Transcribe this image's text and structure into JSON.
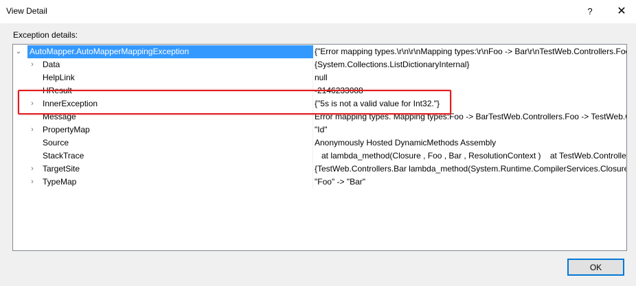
{
  "window": {
    "title": "View Detail",
    "help_label": "?",
    "close_label": "✕"
  },
  "section_label": "Exception details:",
  "tree": {
    "root": {
      "expander": "⌄",
      "name": "AutoMapper.AutoMapperMappingException",
      "value": "{\"Error mapping types.\\r\\n\\r\\nMapping types:\\r\\nFoo -> Bar\\r\\nTestWeb.Controllers.Foo -> TestWeb.Controllers.Bar\"}"
    },
    "rows": [
      {
        "expander": "›",
        "name": "Data",
        "value": "{System.Collections.ListDictionaryInternal}"
      },
      {
        "expander": "",
        "name": "HelpLink",
        "value": "null"
      },
      {
        "expander": "",
        "name": "HResult",
        "value": "-2146233088"
      },
      {
        "expander": "›",
        "name": "InnerException",
        "value": "{\"5s is not a valid value for Int32.\"}"
      },
      {
        "expander": "",
        "name": "Message",
        "value": "Error mapping types. Mapping types:Foo -> BarTestWeb.Controllers.Foo -> TestWeb.Controllers.Bar"
      },
      {
        "expander": "›",
        "name": "PropertyMap",
        "value": "\"Id\""
      },
      {
        "expander": "",
        "name": "Source",
        "value": "Anonymously Hosted DynamicMethods Assembly"
      },
      {
        "expander": "",
        "name": "StackTrace",
        "value": "   at lambda_method(Closure , Foo , Bar , ResolutionContext )    at TestWeb.Controllers.HomeController.Index()"
      },
      {
        "expander": "›",
        "name": "TargetSite",
        "value": "{TestWeb.Controllers.Bar lambda_method(System.Runtime.CompilerServices.Closure, TestWeb.Controllers.Foo)}"
      },
      {
        "expander": "›",
        "name": "TypeMap",
        "value": "\"Foo\" -> \"Bar\""
      }
    ]
  },
  "buttons": {
    "ok_label": "OK"
  },
  "colors": {
    "selection": "#3399ff",
    "highlight_box": "#e21c1c",
    "button_focus": "#0078d7"
  }
}
